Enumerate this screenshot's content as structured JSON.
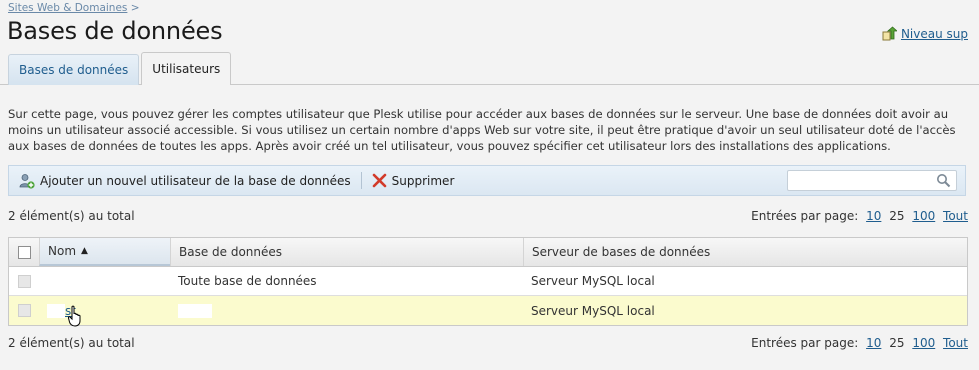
{
  "breadcrumb": {
    "link": "Sites Web & Domaines",
    "separator": ">"
  },
  "page_title": "Bases de données",
  "up_level": {
    "label": "Niveau sup",
    "icon": "up-level-icon"
  },
  "tabs": [
    {
      "label": "Bases de données",
      "active": false
    },
    {
      "label": "Utilisateurs",
      "active": true
    }
  ],
  "description": "Sur cette page, vous pouvez gérer les comptes utilisateur que Plesk utilise pour accéder aux bases de données sur le serveur. Une base de données doit avoir au moins un utilisateur associé accessible. Si vous utilisez un certain nombre d'apps Web sur votre site, il peut être pratique d'avoir un seul utilisateur doté de l'accès aux bases de données de toutes les apps. Après avoir créé un tel utilisateur, vous pouvez spécifier cet utilisateur lors des installations des applications.",
  "toolbar": {
    "add_label": "Ajouter un nouvel utilisateur de la base de données",
    "add_icon": "add-user-icon",
    "delete_label": "Supprimer",
    "delete_icon": "delete-icon",
    "search_value": "",
    "search_icon": "search-icon"
  },
  "summary": {
    "total_label": "2 élément(s) au total",
    "per_page_label": "Entrées par page:",
    "options": [
      "10",
      "25",
      "100",
      "Tout"
    ],
    "selected": "25"
  },
  "table": {
    "columns": {
      "name": "Nom",
      "database": "Base de données",
      "server": "Serveur de bases de données"
    },
    "sort_icon": "sort-ascending-icon",
    "rows": [
      {
        "name": "",
        "database": "Toute base de données",
        "server": "Serveur MySQL local",
        "highlighted": false
      },
      {
        "name": "st",
        "database": "",
        "server": "Serveur MySQL local",
        "highlighted": true
      }
    ]
  },
  "colors": {
    "accent": "#1f5d8e",
    "highlight_row": "#fbfbce",
    "toolbar_bg": "#dbe7f2"
  }
}
